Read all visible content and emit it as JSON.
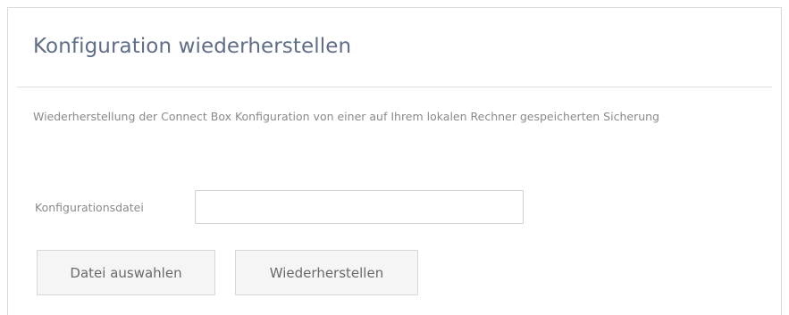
{
  "panel": {
    "title": "Konfiguration wiederherstellen",
    "description": "Wiederherstellung der Connect Box Konfiguration von einer auf Ihrem lokalen Rechner gespeicherten Sicherung"
  },
  "form": {
    "file_label": "Konfigurationsdatei",
    "file_value": "",
    "select_button_label": "Datei auswahlen",
    "restore_button_label": "Wiederherstellen"
  }
}
